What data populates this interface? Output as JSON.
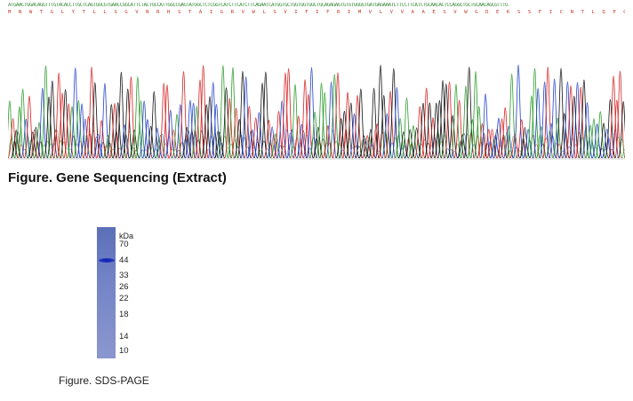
{
  "sequence": {
    "nucleotides": "ATGAACTGGACAGGTTTGTACACCTTGCTCAGTGGCGTGAACCGGCATTCTACTGCCATTGGCCGAGTATGGCTCTCGGTCATCTTCATCTTCAGAATCATGGTGCTGGTGGTGGCTGCAGAGAGTGTGTGGGGTGATGAGAAATCTTCCTTCATCTGCAACACTCCAGGCTGCTGCAACAGCGTTTG",
    "amino_acids": "M N W T G L Y T L L S G V N R H S T A I G R V W L S V I F I F R I M V L V V A A E S V W G D E K S S F I C N T L Q P G C N S V C"
  },
  "chromatogram": {
    "colors": {
      "A": "#2a9a2a",
      "C": "#2342c8",
      "G": "#111111",
      "T": "#d62020"
    }
  },
  "figures": {
    "gene_title": "Figure. Gene Sequencing (Extract)",
    "sds_caption": "Figure. SDS-PAGE"
  },
  "gel": {
    "unit": "kDa",
    "markers": [
      "70",
      "44",
      "33",
      "26",
      "22",
      "18",
      "14",
      "10"
    ],
    "band_kda": 44,
    "band_color": "#0a1fa8",
    "lane_color": "#6e7fc3"
  }
}
